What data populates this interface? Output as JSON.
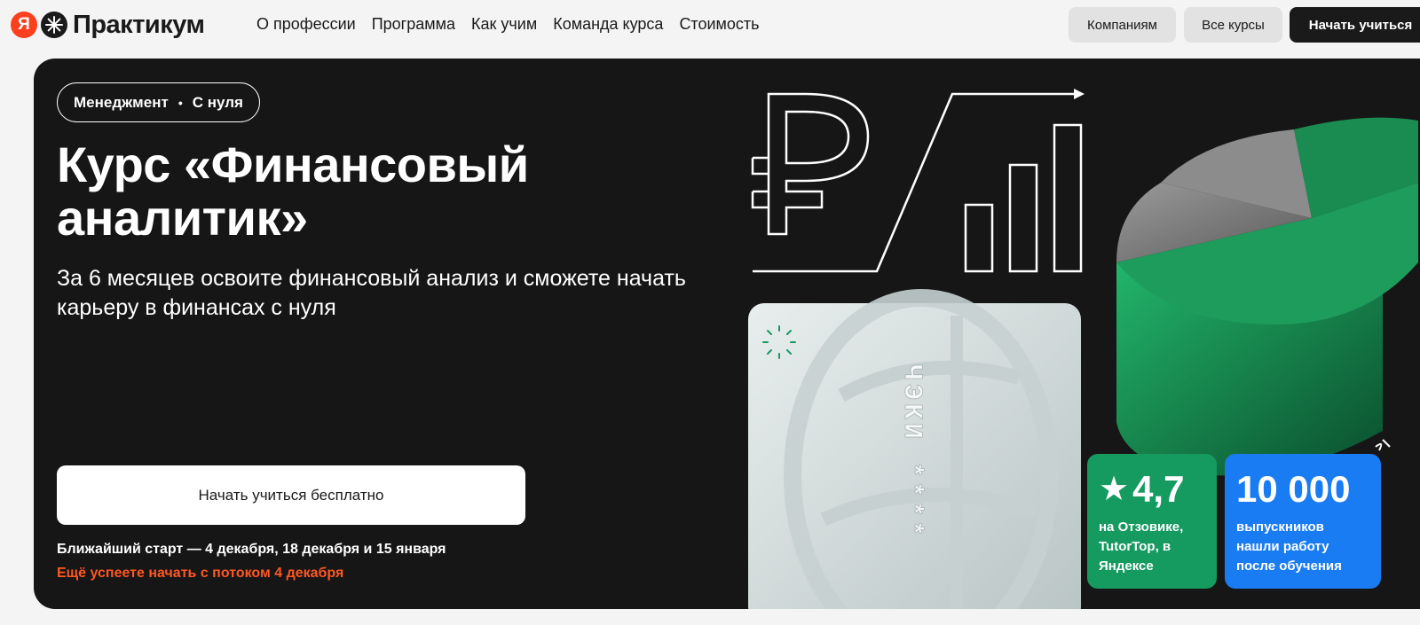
{
  "header": {
    "logo_ya": "Я",
    "logo_text": "Практикум",
    "nav": [
      "О профессии",
      "Программа",
      "Как учим",
      "Команда курса",
      "Стоимость"
    ],
    "companies_label": "Компаниям",
    "all_courses_label": "Все курсы",
    "start_label": "Начать учиться"
  },
  "hero": {
    "tag_category": "Менеджмент",
    "tag_dot": "•",
    "tag_level": "С нуля",
    "title": "Курс «Финансовый аналитик»",
    "subtitle": "За 6 месяцев освоите финансовый анализ и сможете начать карьеру в финансах с нуля",
    "cta_label": "Начать учиться бесплатно",
    "start_dates": "Ближайший старт — 4 декабря, 18 декабря и 15 января",
    "hurry_text": "Ещё успеете начать с потоком 4 декабря"
  },
  "badges": {
    "rating_value": "4,7",
    "rating_text": "на Отзовике, TutorTop, в Яндексе",
    "rating_color": "#159a60",
    "graduates_value": "10 000",
    "graduates_text": "выпускников нашли работу после обучения",
    "graduates_color": "#1a7cf2"
  },
  "art": {
    "ruble_icon": "ruble-icon",
    "card_text": "ЧЭКИ ****"
  }
}
